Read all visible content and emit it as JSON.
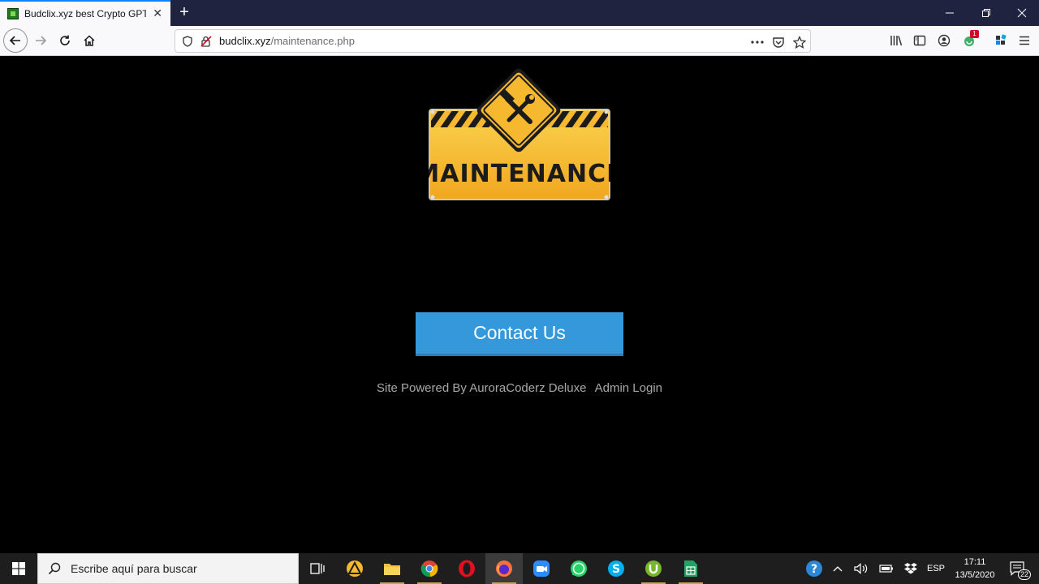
{
  "browser": {
    "tab": {
      "title": "Budclix.xyz best Crypto GPT",
      "close": "✕"
    },
    "new_tab": "+",
    "url": {
      "host": "budclix.xyz",
      "path": "/maintenance.php"
    },
    "notification_badge": "1"
  },
  "page": {
    "sign_text": "MAINTENANCE",
    "contact_button": "Contact Us",
    "footer": {
      "powered_by": "Site Powered By AuroraCoderz Deluxe",
      "admin_login": "Admin Login"
    }
  },
  "taskbar": {
    "search_placeholder": "Escribe aquí para buscar",
    "language": "ESP",
    "time": "17:11",
    "date": "13/5/2020",
    "notifications_count": "22"
  },
  "colors": {
    "contact_button": "#3498db",
    "sign_yellow": "#f5b82e",
    "tab_accent": "#0a84ff"
  }
}
